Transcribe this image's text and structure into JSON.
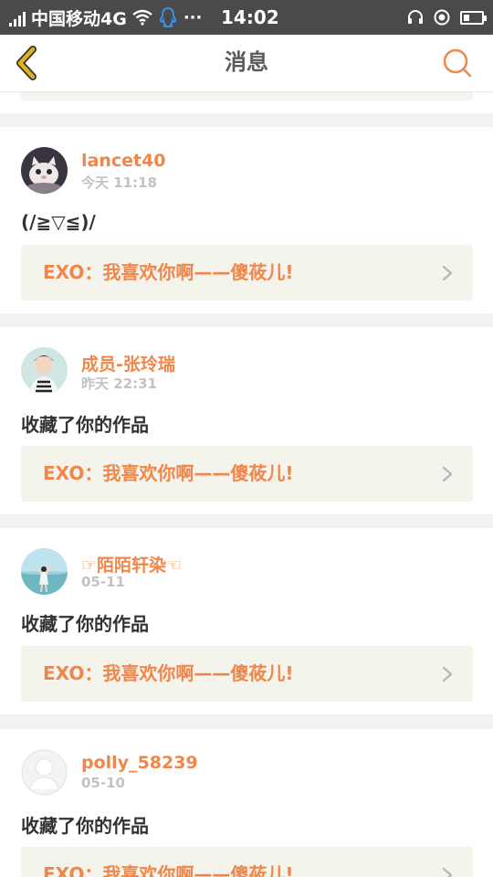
{
  "status_bar": {
    "carrier": "中国移动4G",
    "more": "···",
    "time": "14:02"
  },
  "nav": {
    "title": "消息"
  },
  "colors": {
    "accent": "#f0874a",
    "status_bar_bg": "#4a4a4a",
    "page_bg": "#f2f2f2",
    "work_bg": "#f4f3ec",
    "back_arrow": "#e0b21a"
  },
  "messages": [
    {
      "username": "lancet40",
      "time": "今天 11:18",
      "comment": "(/≧▽≦)/",
      "work_title": "EXO：我喜欢你啊——傻莜儿!",
      "avatar_icon": "cat-avatar"
    },
    {
      "username": "成员-张玲瑞",
      "time": "昨天 22:31",
      "comment": "收藏了你的作品",
      "work_title": "EXO：我喜欢你啊——傻莜儿!",
      "avatar_icon": "boy-avatar"
    },
    {
      "username": "☞陌陌轩染☜",
      "time": "05-11",
      "comment": "收藏了你的作品",
      "work_title": "EXO：我喜欢你啊——傻莜儿!",
      "avatar_icon": "beach-girl-avatar"
    },
    {
      "username": "polly_58239",
      "time": "05-10",
      "comment": "收藏了你的作品",
      "work_title": "EXO：我喜欢你啊——傻莜儿!",
      "avatar_icon": "default-avatar"
    }
  ]
}
